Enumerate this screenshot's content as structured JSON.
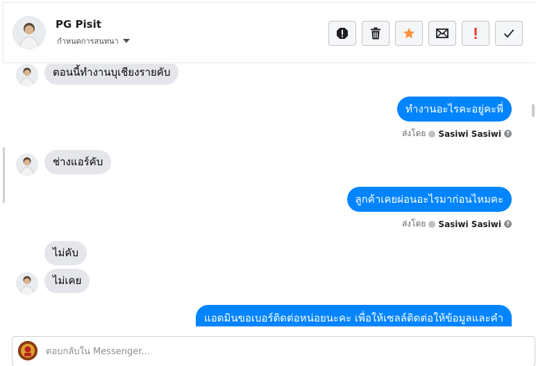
{
  "header": {
    "contact_name": "PG Pisit",
    "subtitle": "กำหนดการสนทนา",
    "tools": [
      {
        "name": "spam-icon"
      },
      {
        "name": "delete-icon"
      },
      {
        "name": "star-icon",
        "color": "#f7923b"
      },
      {
        "name": "mail-icon"
      },
      {
        "name": "important-icon",
        "color": "#e3342f"
      },
      {
        "name": "done-icon"
      }
    ]
  },
  "messages": [
    {
      "dir": "in",
      "text": "ตอนนี้ทำงานบุเชียงรายคับ"
    },
    {
      "dir": "out",
      "text": "ทำงานอะไรคะอยู่คะพี่",
      "sent_by_label": "ส่งโดย",
      "sent_by": "Sasiwi Sasiwi"
    },
    {
      "dir": "in",
      "text": "ช่างแอร์คับ"
    },
    {
      "dir": "out",
      "text": "ลูกค้าเคยผ่อนอะไรมาก่อนไหมคะ",
      "sent_by_label": "ส่งโดย",
      "sent_by": "Sasiwi Sasiwi"
    },
    {
      "dir": "in",
      "text": "ไม่คับ"
    },
    {
      "dir": "in",
      "text": "ไม่เคย"
    },
    {
      "dir": "out",
      "text": "แอดมินขอเบอร์ติดต่อหน่อยนะคะ เพื่อให้เซลล์ติดต่อให้ข้อมูลและคำ"
    }
  ],
  "composer": {
    "placeholder": "ตอบกลับใน Messenger..."
  },
  "colors": {
    "outgoing_bubble": "#0084ff",
    "incoming_bubble": "#e4e6eb"
  }
}
